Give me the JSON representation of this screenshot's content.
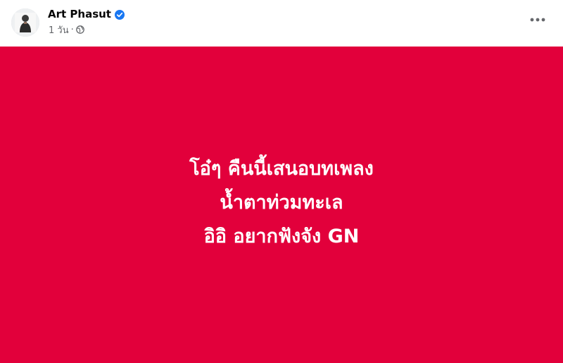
{
  "author": {
    "name": "Art Phasut",
    "verified_icon": "verified-badge-icon"
  },
  "meta": {
    "time": "1 วัน",
    "separator": "·",
    "privacy_icon": "globe-icon"
  },
  "more_icon": "ellipsis-icon",
  "post": {
    "background_color": "#e2003b",
    "text_color": "#ffffff",
    "lines": [
      "โอ๋ๆ คืนนี้เสนอบทเพลง",
      "น้ำตาท่วมทะเล",
      "อิอิ อยากฟังจัง GN"
    ]
  },
  "colors": {
    "verified_blue": "#1877f2",
    "secondary_text": "#65676b"
  }
}
